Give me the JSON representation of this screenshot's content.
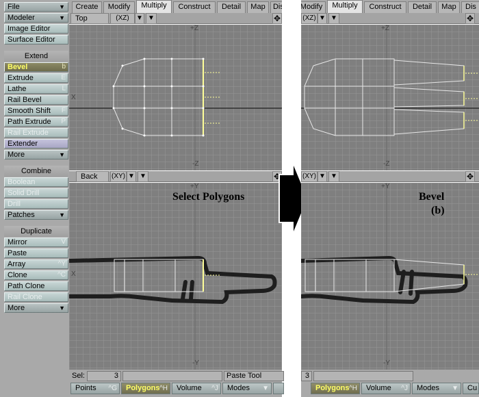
{
  "sidebar": {
    "file": "File",
    "modeler": "Modeler",
    "image_editor": "Image Editor",
    "surface_editor": "Surface Editor",
    "extend_header": "Extend",
    "extend_items": [
      {
        "label": "Bevel",
        "shortcut": "b"
      },
      {
        "label": "Extrude",
        "shortcut": "E"
      },
      {
        "label": "Lathe",
        "shortcut": "L"
      },
      {
        "label": "Rail Bevel",
        "shortcut": ""
      },
      {
        "label": "Smooth Shift",
        "shortcut": "F"
      },
      {
        "label": "Path Extrude",
        "shortcut": "P"
      },
      {
        "label": "Rail Extrude",
        "shortcut": ""
      },
      {
        "label": "Extender",
        "shortcut": ""
      }
    ],
    "extend_more": "More",
    "combine_header": "Combine",
    "combine_items": [
      "Boolean",
      "Solid Drill",
      "Drill"
    ],
    "patches": "Patches",
    "duplicate_header": "Duplicate",
    "duplicate_items": [
      {
        "label": "Mirror",
        "shortcut": "V"
      },
      {
        "label": "Paste",
        "shortcut": ""
      },
      {
        "label": "Array",
        "shortcut": "^Y"
      },
      {
        "label": "Clone",
        "shortcut": "^C"
      },
      {
        "label": "Path Clone",
        "shortcut": ""
      },
      {
        "label": "Rail Clone",
        "shortcut": ""
      }
    ],
    "duplicate_more": "More"
  },
  "tabs_left": [
    "Create",
    "Modify",
    "Multiply",
    "Construct",
    "Detail",
    "Map",
    "Disp"
  ],
  "tabs_right": [
    "Modify",
    "Multiply",
    "Construct",
    "Detail",
    "Map",
    "Dis"
  ],
  "active_tab": "Multiply",
  "viewports": {
    "top_view": "Top",
    "top_axes": "(XZ)",
    "back_view": "Back",
    "back_axes": "(XY)",
    "axis_plus_z": "+Z",
    "axis_minus_z": "-Z",
    "axis_plus_y": "+Y",
    "axis_minus_y": "-Y",
    "axis_x": "X"
  },
  "captions": {
    "select": "Select Polygons",
    "bevel": "Bevel",
    "bevel_key": "(b)"
  },
  "status": {
    "sel_label": "Sel:",
    "sel_value": "3",
    "sel_value_right": "3",
    "tool": "Paste Tool",
    "modes": [
      {
        "label": "Points",
        "key": "^G"
      },
      {
        "label": "Polygons",
        "key": "^H"
      },
      {
        "label": "Volume",
        "key": "^J"
      },
      {
        "label": "Modes",
        "key": ""
      }
    ],
    "right_modes": [
      {
        "label": "Polygons",
        "key": "^H"
      },
      {
        "label": "Volume",
        "key": "^J"
      },
      {
        "label": "Modes",
        "key": ""
      },
      {
        "label": "Cu",
        "key": ""
      }
    ]
  },
  "colors": {
    "viewport_bg": "#808080",
    "grid": "#9a9a9a",
    "mesh": "#ffffff",
    "selected": "#ffff99",
    "active_button": "#6e6c4c"
  }
}
